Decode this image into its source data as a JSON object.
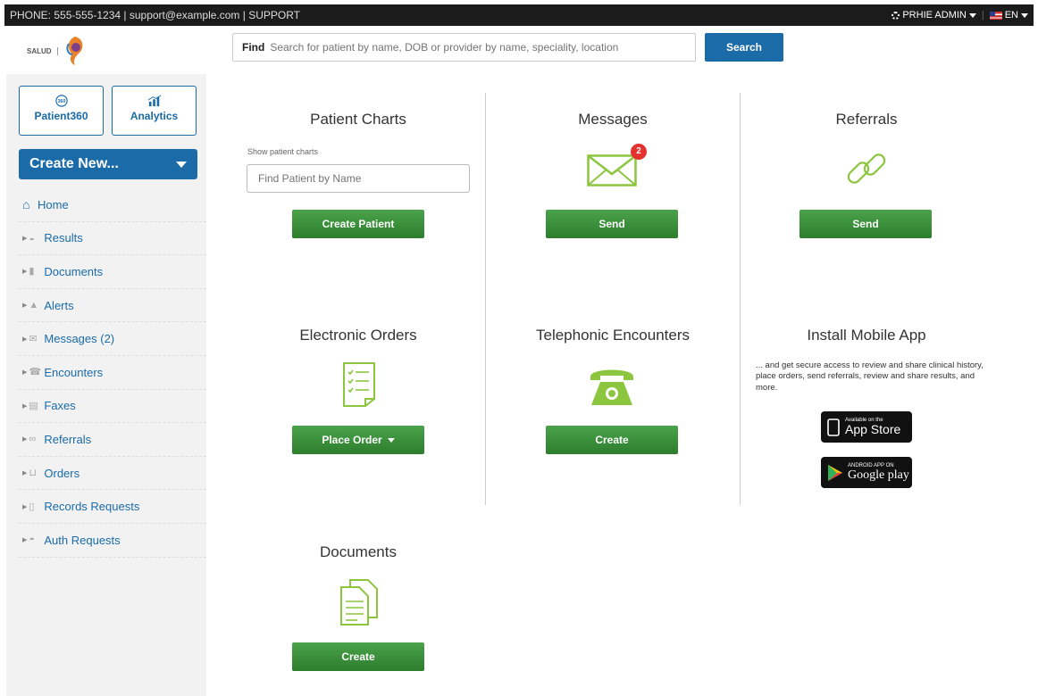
{
  "topbar": {
    "contact": "PHONE: 555-555-1234 | support@example.com | SUPPORT",
    "user": "PRHIE ADMIN",
    "lang": "EN"
  },
  "header": {
    "logo_text": "SALUD",
    "find_label": "Find",
    "search_placeholder": "Search for patient by name, DOB or provider by name, speciality, location",
    "search_button": "Search"
  },
  "sidebar": {
    "patient360": "Patient360",
    "patient360_badge": "360",
    "analytics": "Analytics",
    "create_new": "Create New...",
    "items": [
      {
        "label": "Home",
        "icon": "home-icon"
      },
      {
        "label": "Results",
        "icon": "results-icon"
      },
      {
        "label": "Documents",
        "icon": "documents-icon"
      },
      {
        "label": "Alerts",
        "icon": "alert-icon"
      },
      {
        "label": "Messages (2)",
        "icon": "envelope-icon"
      },
      {
        "label": "Encounters",
        "icon": "phone-icon"
      },
      {
        "label": "Faxes",
        "icon": "fax-icon"
      },
      {
        "label": "Referrals",
        "icon": "link-icon"
      },
      {
        "label": "Orders",
        "icon": "cart-icon"
      },
      {
        "label": "Records Requests",
        "icon": "records-icon"
      },
      {
        "label": "Auth Requests",
        "icon": "auth-icon"
      }
    ]
  },
  "cards": {
    "patient_charts": {
      "title": "Patient Charts",
      "label": "Show patient charts",
      "placeholder": "Find Patient by Name",
      "button": "Create Patient"
    },
    "messages": {
      "title": "Messages",
      "badge": "2",
      "button": "Send"
    },
    "referrals": {
      "title": "Referrals",
      "button": "Send"
    },
    "electronic_orders": {
      "title": "Electronic Orders",
      "button": "Place Order"
    },
    "telephonic": {
      "title": "Telephonic Encounters",
      "button": "Create"
    },
    "mobile": {
      "title": "Install Mobile App",
      "text": "... and get secure access to review and share clinical history, place orders, send referrals, review and share results, and more.",
      "appstore_small": "Available on the",
      "appstore_big": "App Store",
      "gplay_small": "ANDROID APP ON",
      "gplay_big": "Google play"
    },
    "documents": {
      "title": "Documents",
      "button": "Create"
    }
  },
  "colors": {
    "brand_blue": "#1a6ba8",
    "green": "#3c913c",
    "icon_green": "#8cc63f",
    "badge_red": "#e53030"
  }
}
